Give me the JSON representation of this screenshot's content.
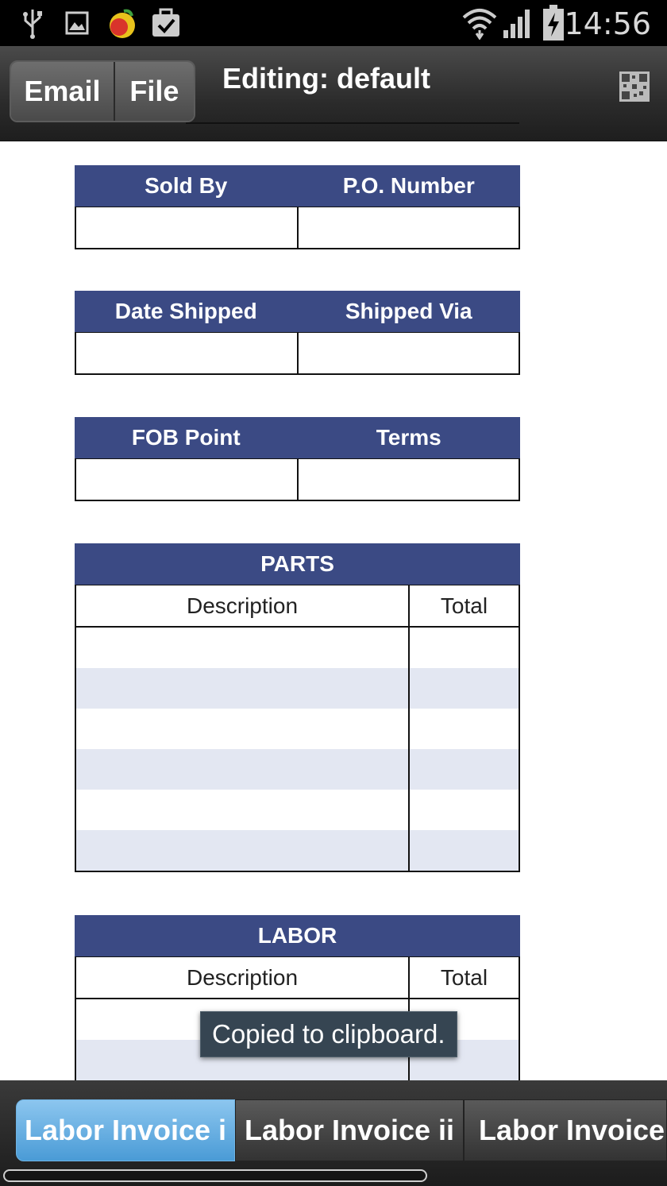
{
  "status_bar": {
    "time": "14:56",
    "icons": [
      "usb-icon",
      "image-icon",
      "app-icon",
      "briefcase-check-icon",
      "wifi-icon",
      "signal-icon",
      "battery-charging-icon"
    ]
  },
  "action_bar": {
    "email_label": "Email",
    "file_label": "File",
    "title": "Editing: default",
    "right_icon": "qr-code-icon"
  },
  "form": {
    "table1": {
      "col1": "Sold By",
      "col2": "P.O. Number"
    },
    "table2": {
      "col1": "Date Shipped",
      "col2": "Shipped Via"
    },
    "table3": {
      "col1": "FOB Point",
      "col2": "Terms"
    },
    "parts": {
      "title": "PARTS",
      "description": "Description",
      "total": "Total"
    },
    "labor": {
      "title": "LABOR",
      "description": "Description",
      "total": "Total"
    }
  },
  "toast": {
    "message": "Copied to clipboard."
  },
  "tabs": [
    {
      "label": "Labor Invoice i",
      "active": true
    },
    {
      "label": "Labor Invoice ii",
      "active": false
    },
    {
      "label": "Labor Invoice",
      "active": false
    }
  ],
  "colors": {
    "header_bg": "#3b4a84",
    "stripe": "#e3e7f2",
    "active_tab": "#4a9bd6"
  }
}
